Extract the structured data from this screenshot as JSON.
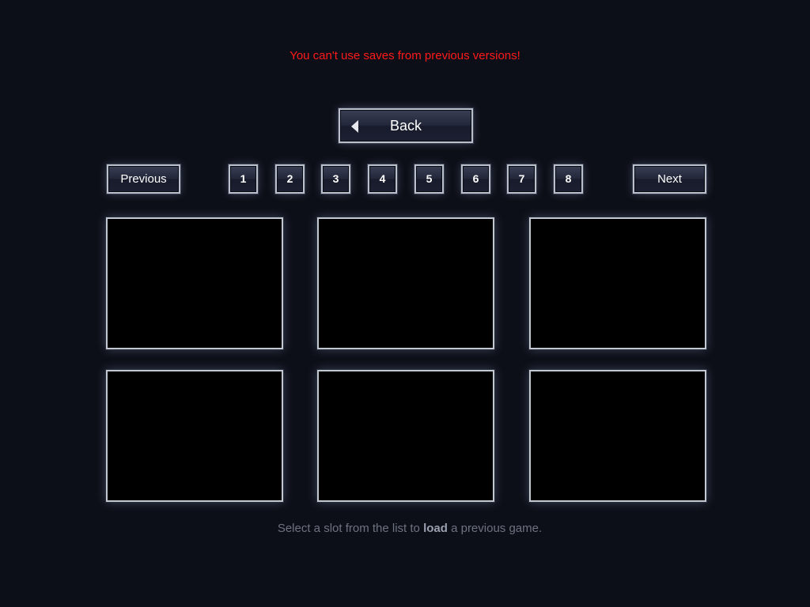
{
  "warning": "You can't use saves from previous versions!",
  "back_button": {
    "label": "Back",
    "icon": "left-triangle-icon"
  },
  "navigation": {
    "previous_label": "Previous",
    "next_label": "Next",
    "pages": [
      "1",
      "2",
      "3",
      "4",
      "5",
      "6",
      "7",
      "8"
    ]
  },
  "slots": [
    "",
    "",
    "",
    "",
    "",
    ""
  ],
  "hint": {
    "prefix": "Select a slot from the list to ",
    "bold": "load",
    "suffix": " a previous game."
  },
  "colors": {
    "background": "#0d0f18",
    "warning": "#ff1a1a",
    "hint_text": "#6e7382",
    "slot_fill": "#000000",
    "frame": "#c2c8d2"
  }
}
